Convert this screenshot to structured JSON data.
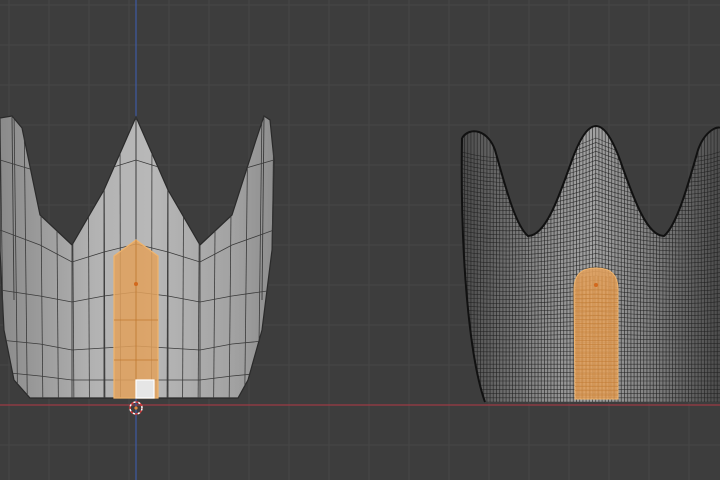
{
  "viewport": {
    "mode": "edit-mode-face-select",
    "background": "#3d3d3d",
    "grid_color": "#464646",
    "x_axis_color": "#9b3b44",
    "y_axis_color": "#3e5aa3"
  },
  "objects": [
    {
      "name": "low-poly-crown",
      "prongs": 3,
      "shading": "solid-wireframe",
      "base_color": "#a7a7a7",
      "wire_color": "#3a3a3a",
      "selected_face_color": "#e2a15c",
      "selected_faces": "front-center-column"
    },
    {
      "name": "subdivided-crown",
      "prongs": 3,
      "shading": "dense-wireframe",
      "base_color": "#8f8f8f",
      "wire_color": "#1e1e1e",
      "selected_face_color": "#e2a15c",
      "selected_faces": "front-center-column"
    }
  ],
  "gizmos": {
    "origin": "object-origin-icon",
    "cursor": "3d-cursor-icon",
    "active_vertex": "active-vertex-icon"
  }
}
